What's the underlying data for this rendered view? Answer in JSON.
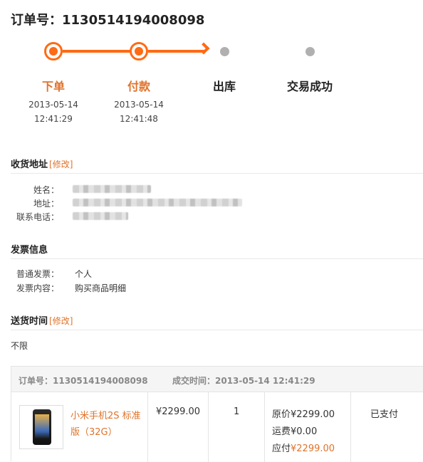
{
  "order": {
    "title": "订单号：1130514194008098"
  },
  "progress": {
    "steps": [
      {
        "label": "下单",
        "date": "2013-05-14",
        "time": "12:41:29",
        "status": "done"
      },
      {
        "label": "付款",
        "date": "2013-05-14",
        "time": "12:41:48",
        "status": "done"
      },
      {
        "label": "出库",
        "status": "pending"
      },
      {
        "label": "交易成功",
        "status": "pending"
      }
    ]
  },
  "address": {
    "title": "收货地址",
    "edit": "[修改]",
    "name_label": "姓名：",
    "address_label": "地址：",
    "phone_label": "联系电话："
  },
  "invoice": {
    "title": "发票信息",
    "type_label": "普通发票：",
    "type_value": "个人",
    "content_label": "发票内容：",
    "content_value": "购买商品明细"
  },
  "delivery": {
    "title": "送货时间",
    "edit": "[修改]",
    "value": "不限"
  },
  "order_table": {
    "order_no": "订单号：1130514194008098",
    "deal_time": "成交时间：2013-05-14 12:41:29",
    "product_name": "小米手机2S 标准版（32G）",
    "unit_price": "¥2299.00",
    "quantity": "1",
    "original_price": "原价¥2299.00",
    "shipping": "运费¥0.00",
    "payable_label": "应付",
    "payable_value": "¥2299.00",
    "status": "已支付"
  },
  "colors": {
    "accent": "#ff6a14",
    "accent_text": "#e0732a",
    "pending_dot": "#b0b0b0"
  }
}
